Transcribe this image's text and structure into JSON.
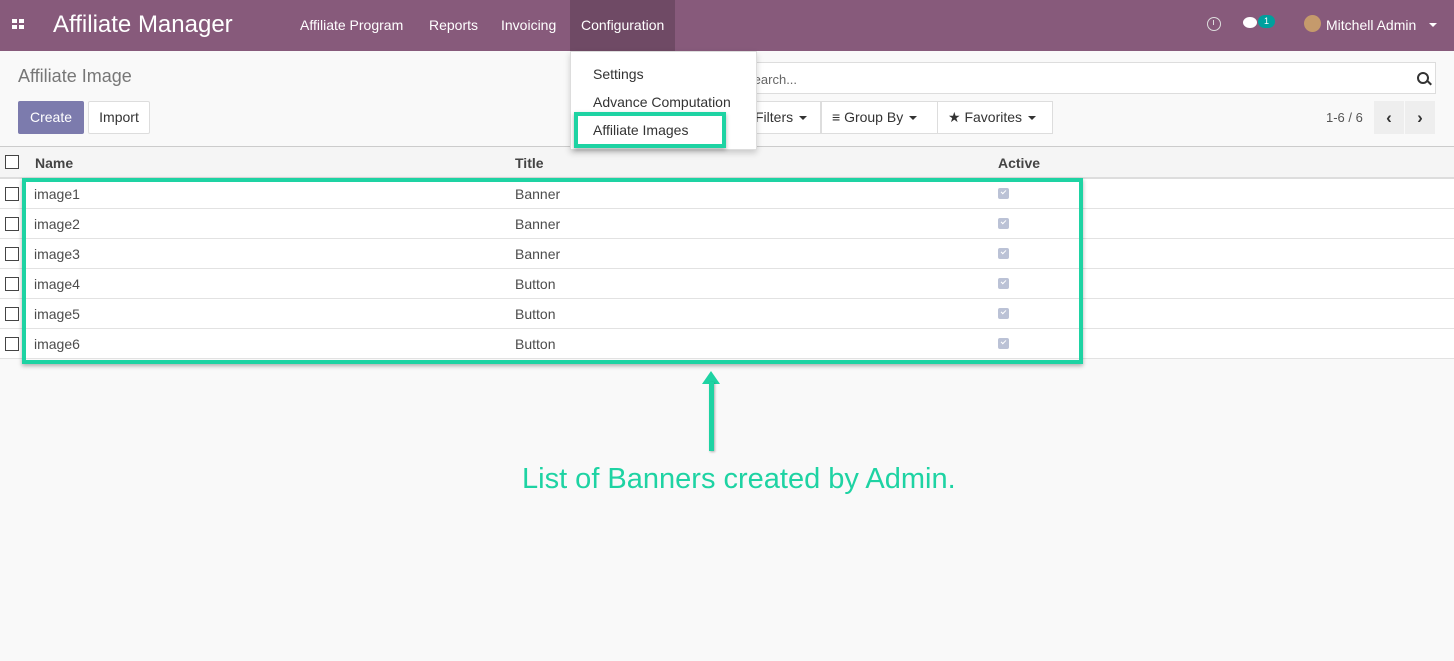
{
  "navbar": {
    "brand": "Affiliate Manager",
    "menus": [
      "Affiliate Program",
      "Reports",
      "Invoicing",
      "Configuration"
    ],
    "chat_count": "1",
    "user": "Mitchell Admin"
  },
  "control_panel": {
    "title": "Affiliate Image",
    "create_label": "Create",
    "import_label": "Import",
    "search_placeholder": "Search...",
    "filters_label": "Filters",
    "groupby_label": "Group By",
    "favorites_label": "Favorites",
    "pager": "1-6 / 6"
  },
  "config_dropdown": {
    "items": [
      "Settings",
      "Advance Computation",
      "Affiliate Images"
    ]
  },
  "table": {
    "columns": [
      "Name",
      "Title",
      "Active"
    ],
    "rows": [
      {
        "name": "image1",
        "title": "Banner",
        "active": true
      },
      {
        "name": "image2",
        "title": "Banner",
        "active": true
      },
      {
        "name": "image3",
        "title": "Banner",
        "active": true
      },
      {
        "name": "image4",
        "title": "Button",
        "active": true
      },
      {
        "name": "image5",
        "title": "Button",
        "active": true
      },
      {
        "name": "image6",
        "title": "Button",
        "active": true
      }
    ]
  },
  "annotation": {
    "caption": "List of Banners created by Admin.",
    "accent_color": "#1ed3a3"
  },
  "colors": {
    "navbar": "#875a7b",
    "primary_button": "#7c7bad"
  }
}
